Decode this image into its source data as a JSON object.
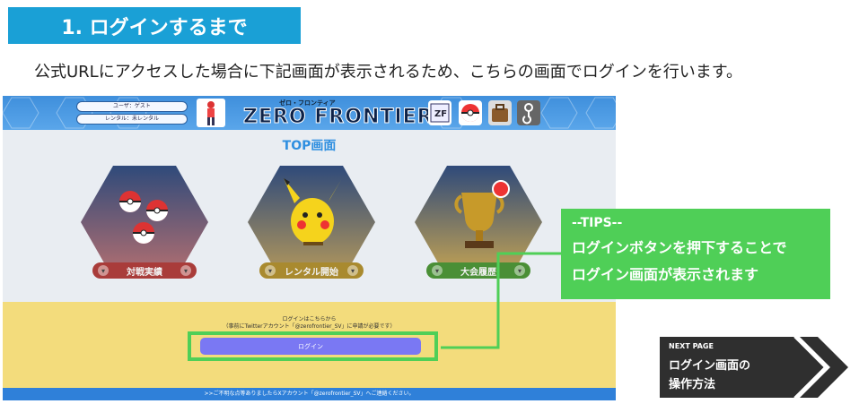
{
  "title": "1. ログインするまで",
  "intro": "公式URLにアクセスした場合に下記画面が表示されるため、こちらの画面でログインを行います。",
  "app": {
    "header": {
      "user_label": "ユーザ：ゲスト",
      "rental_label": "レンタル：未レンタル",
      "logo_small": "ゼロ・フロンティア",
      "logo_main": "ZERO FRONTIER",
      "icons": [
        "trainer-icon",
        "zf-app-icon",
        "pokeball-icon",
        "bag-icon",
        "hook-icon"
      ]
    },
    "page_title": "TOP画面",
    "cards": [
      {
        "label": "対戦実績",
        "icon": "pokeballs-icon",
        "color": "#b8433f"
      },
      {
        "label": "レンタル開始",
        "icon": "pikachu-icon",
        "color": "#b58f2e"
      },
      {
        "label": "大会履歴",
        "icon": "trophy-icon",
        "color": "#4f9e3a"
      }
    ],
    "login": {
      "note_line1": "ログインはこちらから",
      "note_line2": "（事前にTwitterアカウント「@zerofrontier_SV」に申請が必要です）",
      "button_label": "ログイン"
    },
    "footer": ">>ご不明な点等ありましたらXアカウント「@zerofrontier_SV」へご連絡ください。"
  },
  "tips": {
    "heading": "--TIPS--",
    "line1": "ログインボタンを押下することで",
    "line2": "ログイン画面が表示されます"
  },
  "next_page": {
    "label": "NEXT PAGE",
    "line1": "ログイン画面の",
    "line2": "操作方法"
  },
  "colors": {
    "banner": "#1aa0d6",
    "highlight_green": "#4fcf57",
    "login_button": "#7a78f3",
    "login_area": "#f3dc7c",
    "header_blue": "#3f8fdc"
  }
}
